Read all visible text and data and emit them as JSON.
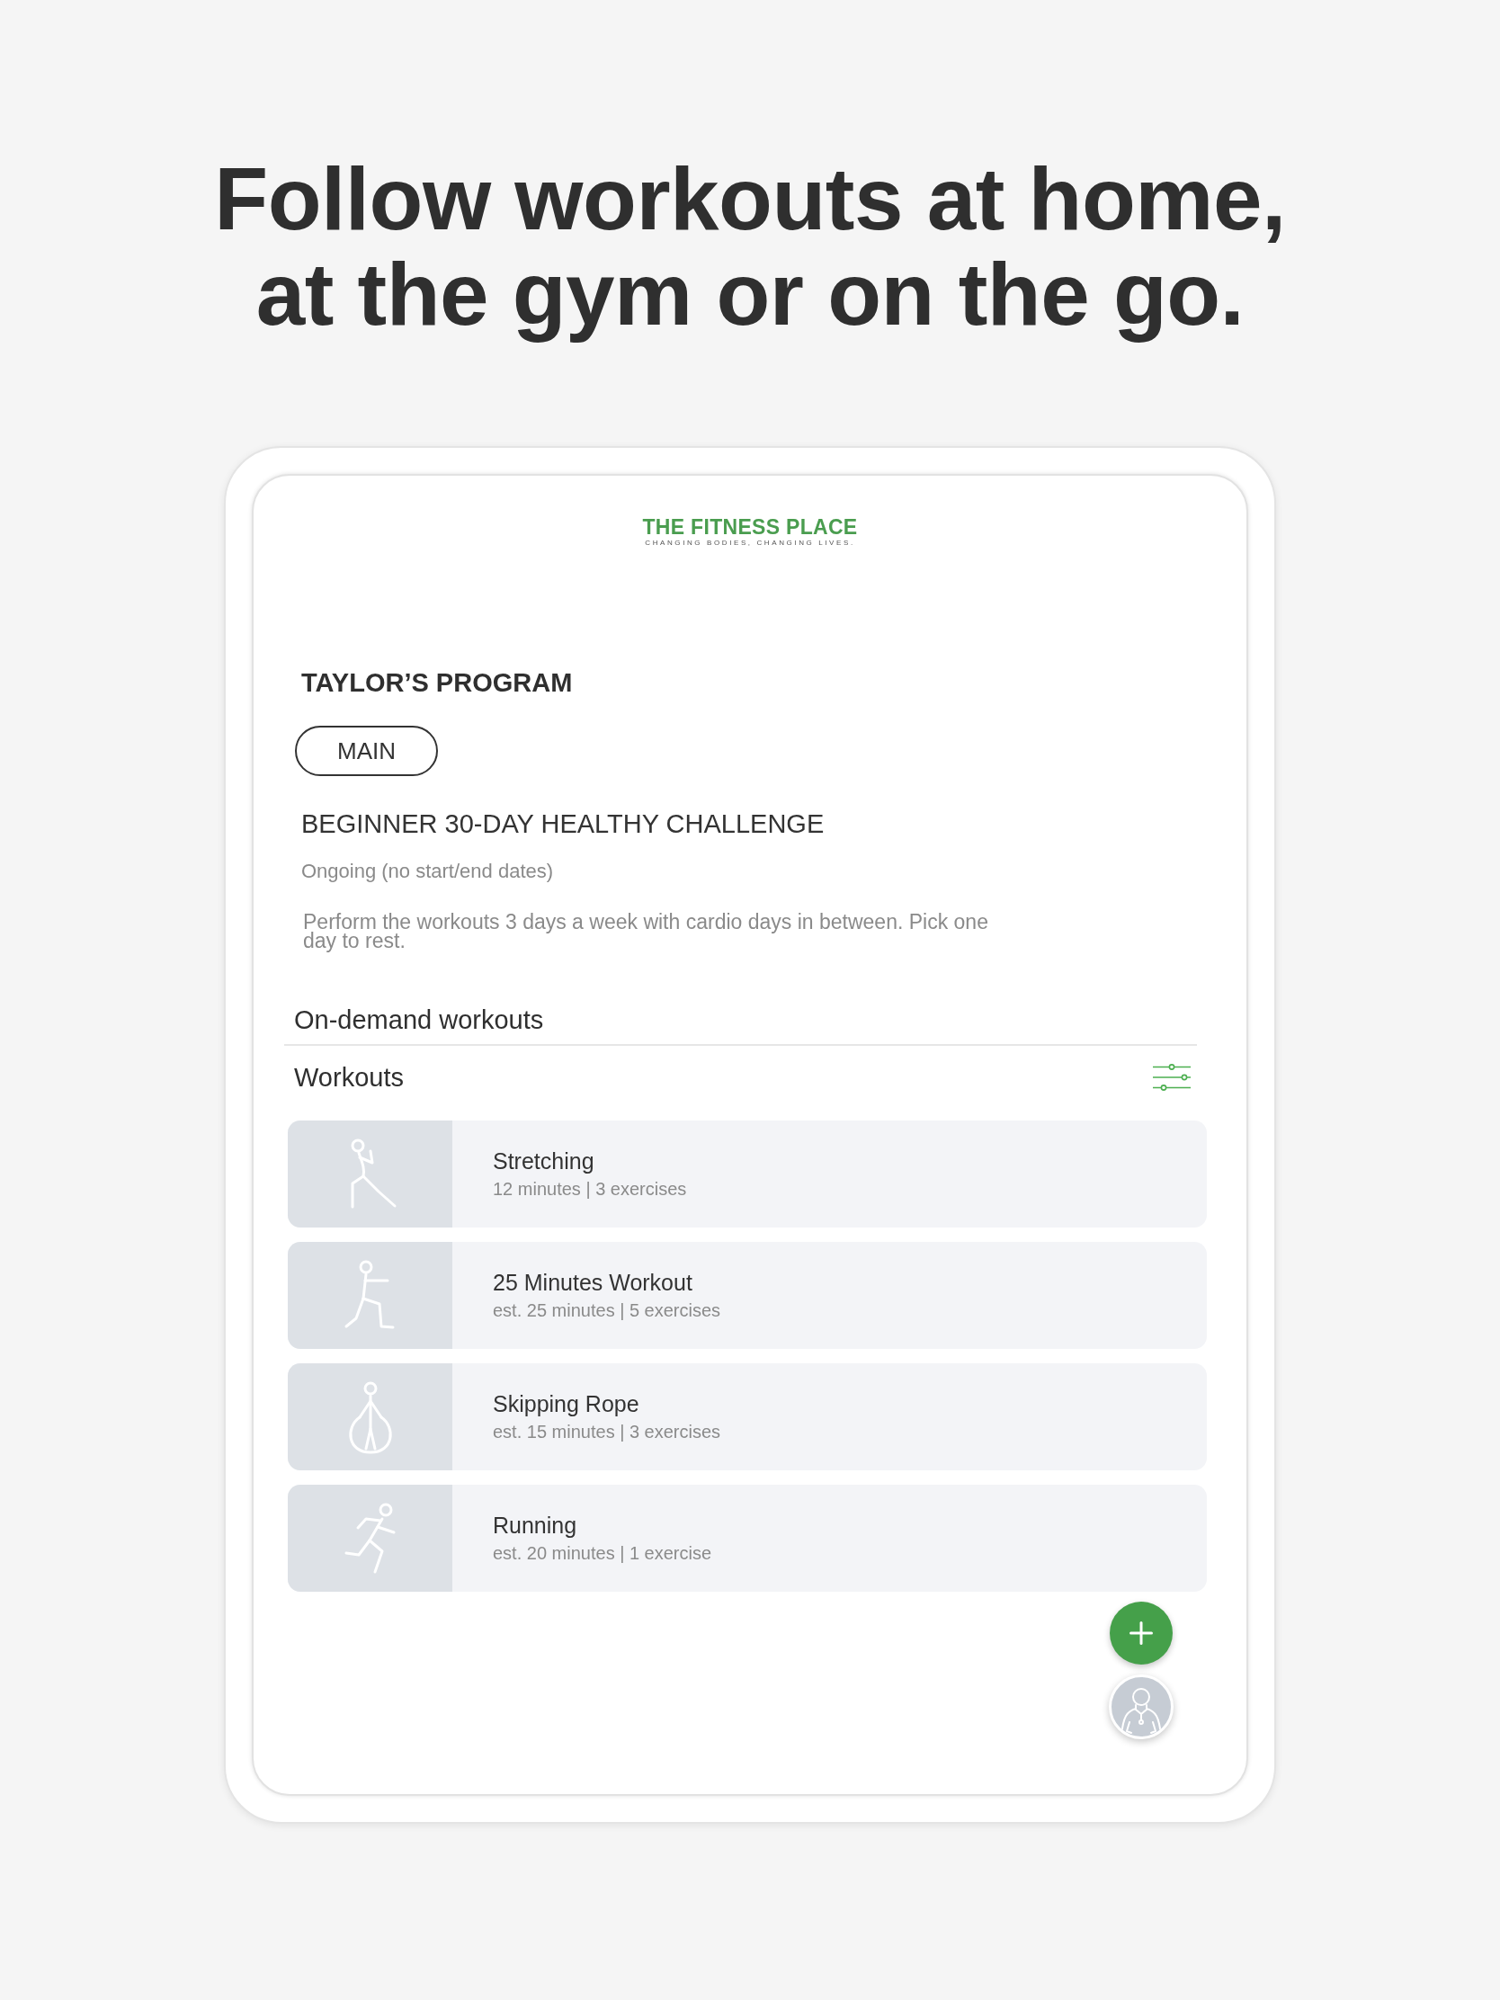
{
  "headline": "Follow workouts at home, at the gym or on the go.",
  "logo": {
    "name": "THE FITNESS PLACE",
    "tagline": "CHANGING BODIES, CHANGING LIVES."
  },
  "program": {
    "owner_title": "TAYLOR’S PROGRAM",
    "tag": "MAIN",
    "name": "BEGINNER 30-DAY HEALTHY CHALLENGE",
    "schedule": "Ongoing (no start/end dates)",
    "description": "Perform the workouts 3 days a week with cardio days in between. Pick one day to rest."
  },
  "on_demand": {
    "title": "On-demand workouts",
    "section": "Workouts",
    "workouts": [
      {
        "kind": "stretch",
        "title": "Stretching",
        "details": "12 minutes | 3 exercises"
      },
      {
        "kind": "lunge",
        "title": "25 Minutes Workout",
        "details": "est. 25 minutes | 5 exercises"
      },
      {
        "kind": "jump-rope",
        "title": "Skipping Rope",
        "details": "est. 15 minutes | 3 exercises"
      },
      {
        "kind": "running",
        "title": "Running",
        "details": "est. 20 minutes | 1 exercise"
      }
    ]
  }
}
